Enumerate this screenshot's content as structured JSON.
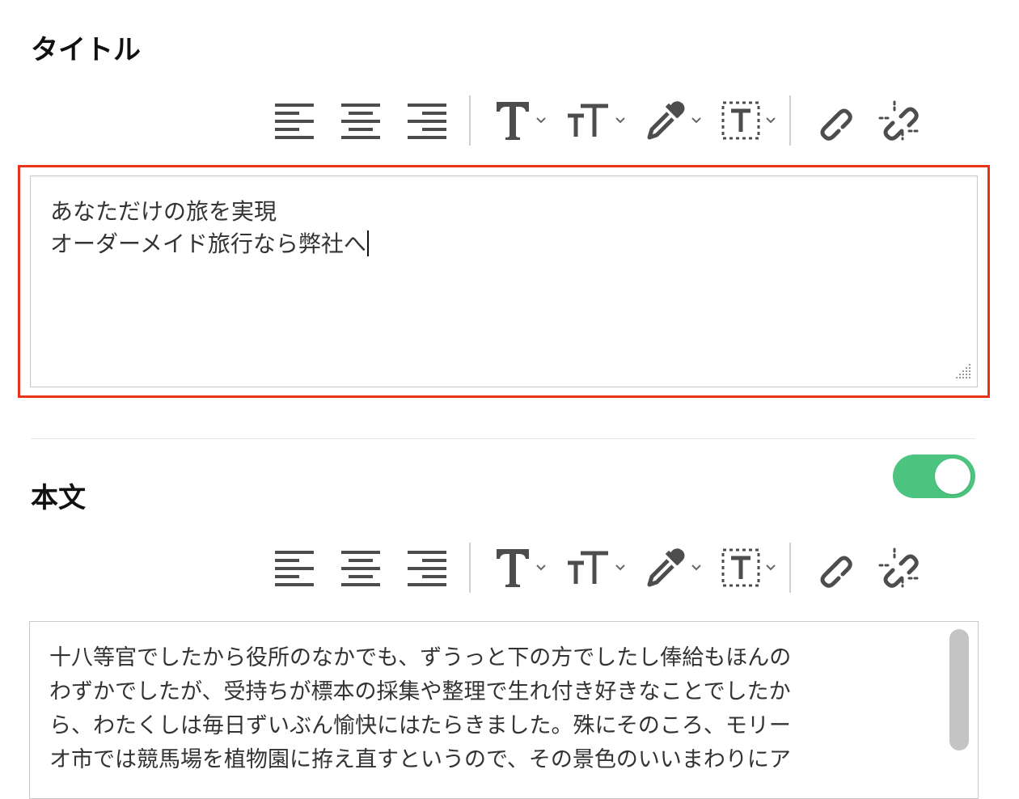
{
  "title_section": {
    "label": "タイトル",
    "text_lines": [
      "あなただけの旅を実現",
      "オーダーメイド旅行なら弊社へ"
    ]
  },
  "body_section": {
    "label": "本文",
    "toggle_on": true,
    "text_lines": [
      "十八等官でしたから役所のなかでも、ずうっと下の方でしたし俸給もほんの",
      "わずかでしたが、受持ちが標本の採集や整理で生れ付き好きなことでしたか",
      "ら、わたくしは毎日ずいぶん愉快にはたらきました。殊にそのころ、モリー",
      "オ市では競馬場を植物園に拵え直すというので、その景色のいいまわりにア"
    ]
  },
  "toolbar": {
    "buttons": [
      "align-left",
      "align-center",
      "align-right",
      "text-style",
      "font-size",
      "text-color",
      "text-box",
      "link",
      "unlink"
    ]
  },
  "colors": {
    "highlight_border": "#e8341c",
    "toggle_on": "#4cc47f",
    "icon": "#4d4d4d"
  }
}
